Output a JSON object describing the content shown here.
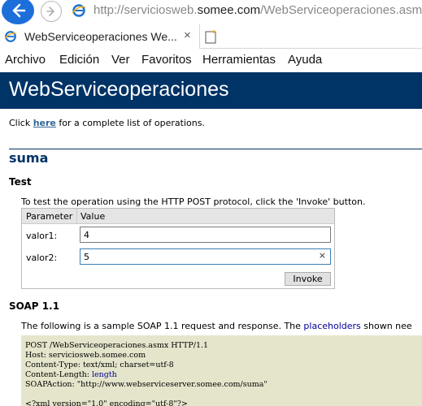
{
  "browser": {
    "url_prefix": "http://serviciosweb.",
    "url_domain": "somee.com",
    "url_suffix": "/WebServiceoperaciones.asmx",
    "tab_title": "WebServiceoperaciones We...",
    "tab_close": "×",
    "menu": [
      "Archivo",
      "Edición",
      "Ver",
      "Favoritos",
      "Herramientas",
      "Ayuda"
    ]
  },
  "page": {
    "heading": "WebServiceoperaciones",
    "intro_before": "Click ",
    "intro_link": "here",
    "intro_after": " for a complete list of operations.",
    "operation": "suma",
    "test_title": "Test",
    "test_desc": "To test the operation using the HTTP POST protocol, click the 'Invoke' button.",
    "form": {
      "col_parameter": "Parameter",
      "col_value": "Value",
      "params": [
        {
          "name": "valor1:",
          "value": "4"
        },
        {
          "name": "valor2:",
          "value": "5"
        }
      ],
      "clear": "×",
      "invoke_label": "Invoke"
    },
    "soap_title": "SOAP 1.1",
    "soap_desc_before": "The following is a sample SOAP 1.1 request and response. The ",
    "soap_desc_link": "placeholders",
    "soap_desc_after": " shown nee",
    "code": {
      "line1": "POST /WebServiceoperaciones.asmx HTTP/1.1",
      "line2": "Host: serviciosweb.somee.com",
      "line3": "Content-Type: text/xml; charset=utf-8",
      "line4_label": "Content-Length: ",
      "line4_value": "length",
      "line5": "SOAPAction: \"http://www.webserviceserver.somee.com/suma\"",
      "line6": "<?xml version=\"1.0\" encoding=\"utf-8\"?>"
    }
  }
}
